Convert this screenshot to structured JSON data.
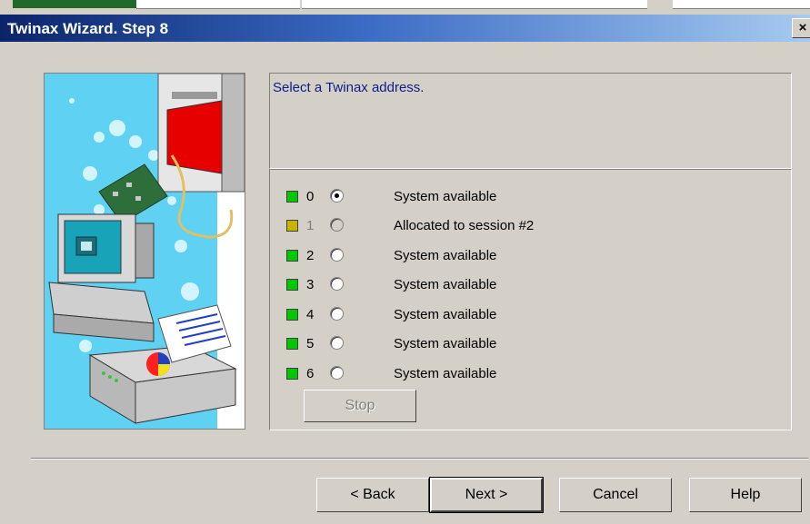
{
  "window": {
    "title": "Twinax Wizard. Step 8",
    "close_label": "×"
  },
  "description": "Select a Twinax address.",
  "addresses": [
    {
      "num": "0",
      "status": "System available",
      "color": "#00c800",
      "selected": true,
      "enabled": true
    },
    {
      "num": "1",
      "status": "Allocated to session #2",
      "color": "#c8b400",
      "selected": false,
      "enabled": false
    },
    {
      "num": "2",
      "status": "System available",
      "color": "#00c800",
      "selected": false,
      "enabled": true
    },
    {
      "num": "3",
      "status": "System available",
      "color": "#00c800",
      "selected": false,
      "enabled": true
    },
    {
      "num": "4",
      "status": "System available",
      "color": "#00c800",
      "selected": false,
      "enabled": true
    },
    {
      "num": "5",
      "status": "System available",
      "color": "#00c800",
      "selected": false,
      "enabled": true
    },
    {
      "num": "6",
      "status": "System available",
      "color": "#00c800",
      "selected": false,
      "enabled": true
    }
  ],
  "buttons": {
    "stop": "Stop",
    "back": "< Back",
    "next": "Next >",
    "cancel": "Cancel",
    "help": "Help"
  }
}
